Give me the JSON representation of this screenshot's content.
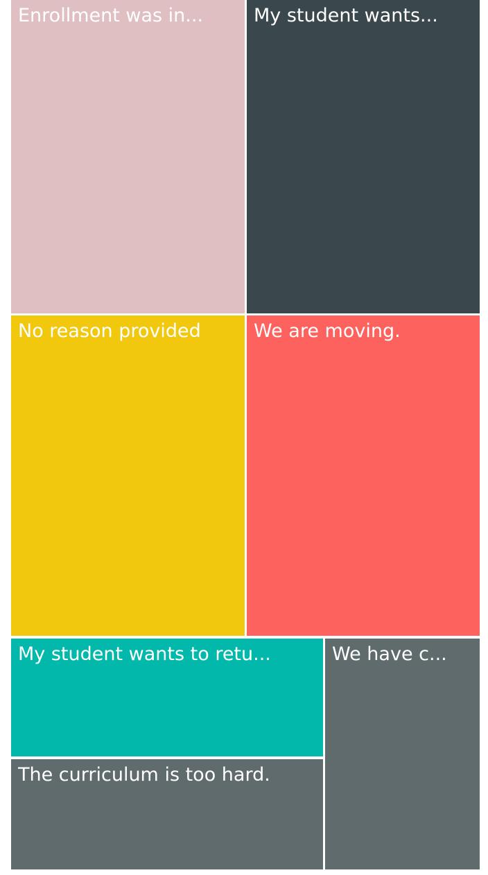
{
  "chart_data": {
    "type": "treemap",
    "title": "",
    "items": [
      {
        "label": "Enrollment was in...",
        "color": "#DFBFC2"
      },
      {
        "label": "My student wants...",
        "color": "#3A474C"
      },
      {
        "label": "No reason provided",
        "color": "#F2C80F"
      },
      {
        "label": "We are moving.",
        "color": "#FD625E"
      },
      {
        "label": "My student wants to retu...",
        "color": "#01B8AA"
      },
      {
        "label": "The curriculum is too hard.",
        "color": "#5F6B6D"
      },
      {
        "label": "We have c...",
        "color": "#5F6B6D"
      }
    ]
  }
}
